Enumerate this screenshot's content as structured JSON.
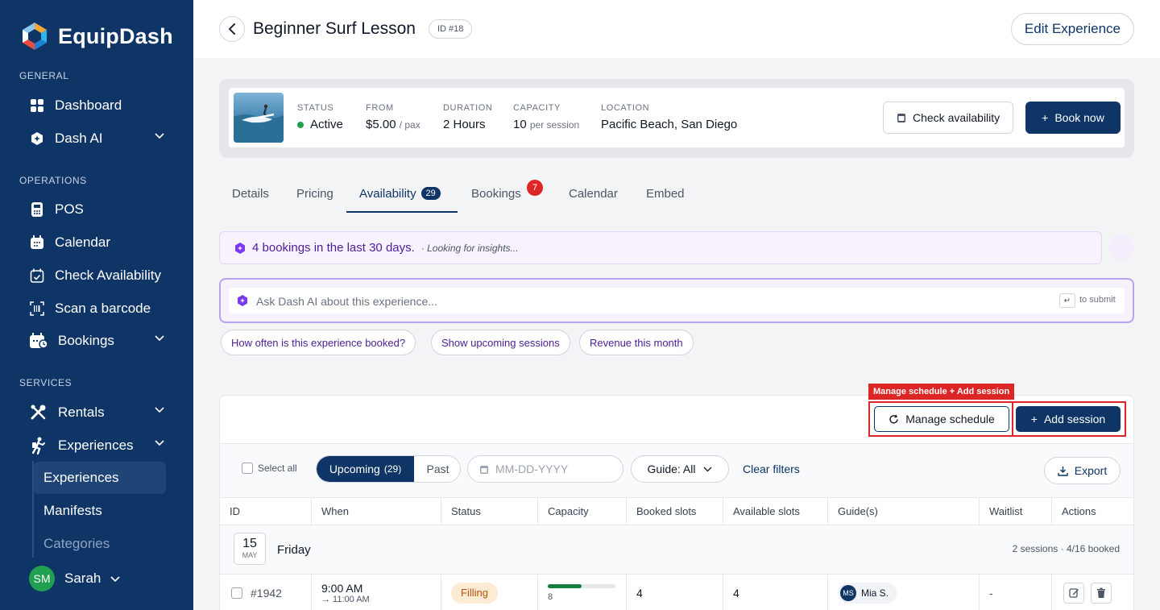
{
  "sidebar": {
    "brand": "EquipDash",
    "sections": {
      "general": "GENERAL",
      "operations": "OPERATIONS",
      "services": "SERVICES"
    },
    "items": {
      "dashboard": "Dashboard",
      "dash_ai": "Dash AI",
      "pos": "POS",
      "calendar": "Calendar",
      "check_availability": "Check Availability",
      "scan_barcode": "Scan a barcode",
      "bookings": "Bookings",
      "rentals": "Rentals",
      "experiences": "Experiences"
    },
    "sub_items": {
      "experiences": "Experiences",
      "manifests": "Manifests",
      "categories": "Categories"
    },
    "user": {
      "initials": "SM",
      "name": "Sarah"
    },
    "colors": {
      "background": "#0e3566",
      "active": "#1f4577"
    }
  },
  "header": {
    "title": "Beginner Surf Lesson",
    "id_badge": "ID #18",
    "edit_label": "Edit Experience"
  },
  "summary": {
    "status_label": "STATUS",
    "status_value": "Active",
    "from_label": "FROM",
    "from_value": "$5.00",
    "from_unit": "/ pax",
    "duration_label": "DURATION",
    "duration_value": "2 Hours",
    "capacity_label": "CAPACITY",
    "capacity_value": "10",
    "capacity_unit": "per session",
    "location_label": "LOCATION",
    "location_value": "Pacific Beach, San Diego",
    "check_label": "Check availability",
    "book_label": "Book now"
  },
  "tabs": {
    "details": "Details",
    "pricing": "Pricing",
    "availability": "Availability",
    "availability_count": "29",
    "bookings": "Bookings",
    "bookings_badge": "7",
    "calendar": "Calendar",
    "embed": "Embed"
  },
  "insight": {
    "text": "4 bookings in the last 30 days.",
    "sub": "· Looking for insights..."
  },
  "ask": {
    "placeholder": "Ask Dash AI about this experience...",
    "submit_hint": "to submit",
    "chips": [
      "How often is this experience booked?",
      "Show upcoming sessions",
      "Revenue this month"
    ]
  },
  "annotation": {
    "label": "Manage schedule + Add session",
    "color": "#dc2626"
  },
  "actions": {
    "manage": "Manage schedule",
    "add": "Add session"
  },
  "filters": {
    "select_all": "Select all",
    "upcoming": "Upcoming",
    "upcoming_count": "(29)",
    "past": "Past",
    "date_placeholder": "MM-DD-YYYY",
    "guide": "Guide: All",
    "clear": "Clear filters",
    "export": "Export"
  },
  "table": {
    "columns": [
      "ID",
      "When",
      "Status",
      "Capacity",
      "Booked slots",
      "Available slots",
      "Guide(s)",
      "Waitlist",
      "Actions"
    ],
    "groups": [
      {
        "day_num": "15",
        "month": "MAY",
        "weekday": "Friday",
        "summary": "2 sessions · 4/16 booked",
        "rows": [
          {
            "id": "#1942",
            "start": "9:00 AM",
            "end": "→ 11:00 AM",
            "status": "Filling",
            "capacity": "8",
            "capacity_fill": 0.5,
            "booked": "4",
            "available": "4",
            "guide_initials": "MS",
            "guide_name": "Mia S.",
            "waitlist": "-"
          }
        ]
      }
    ]
  }
}
